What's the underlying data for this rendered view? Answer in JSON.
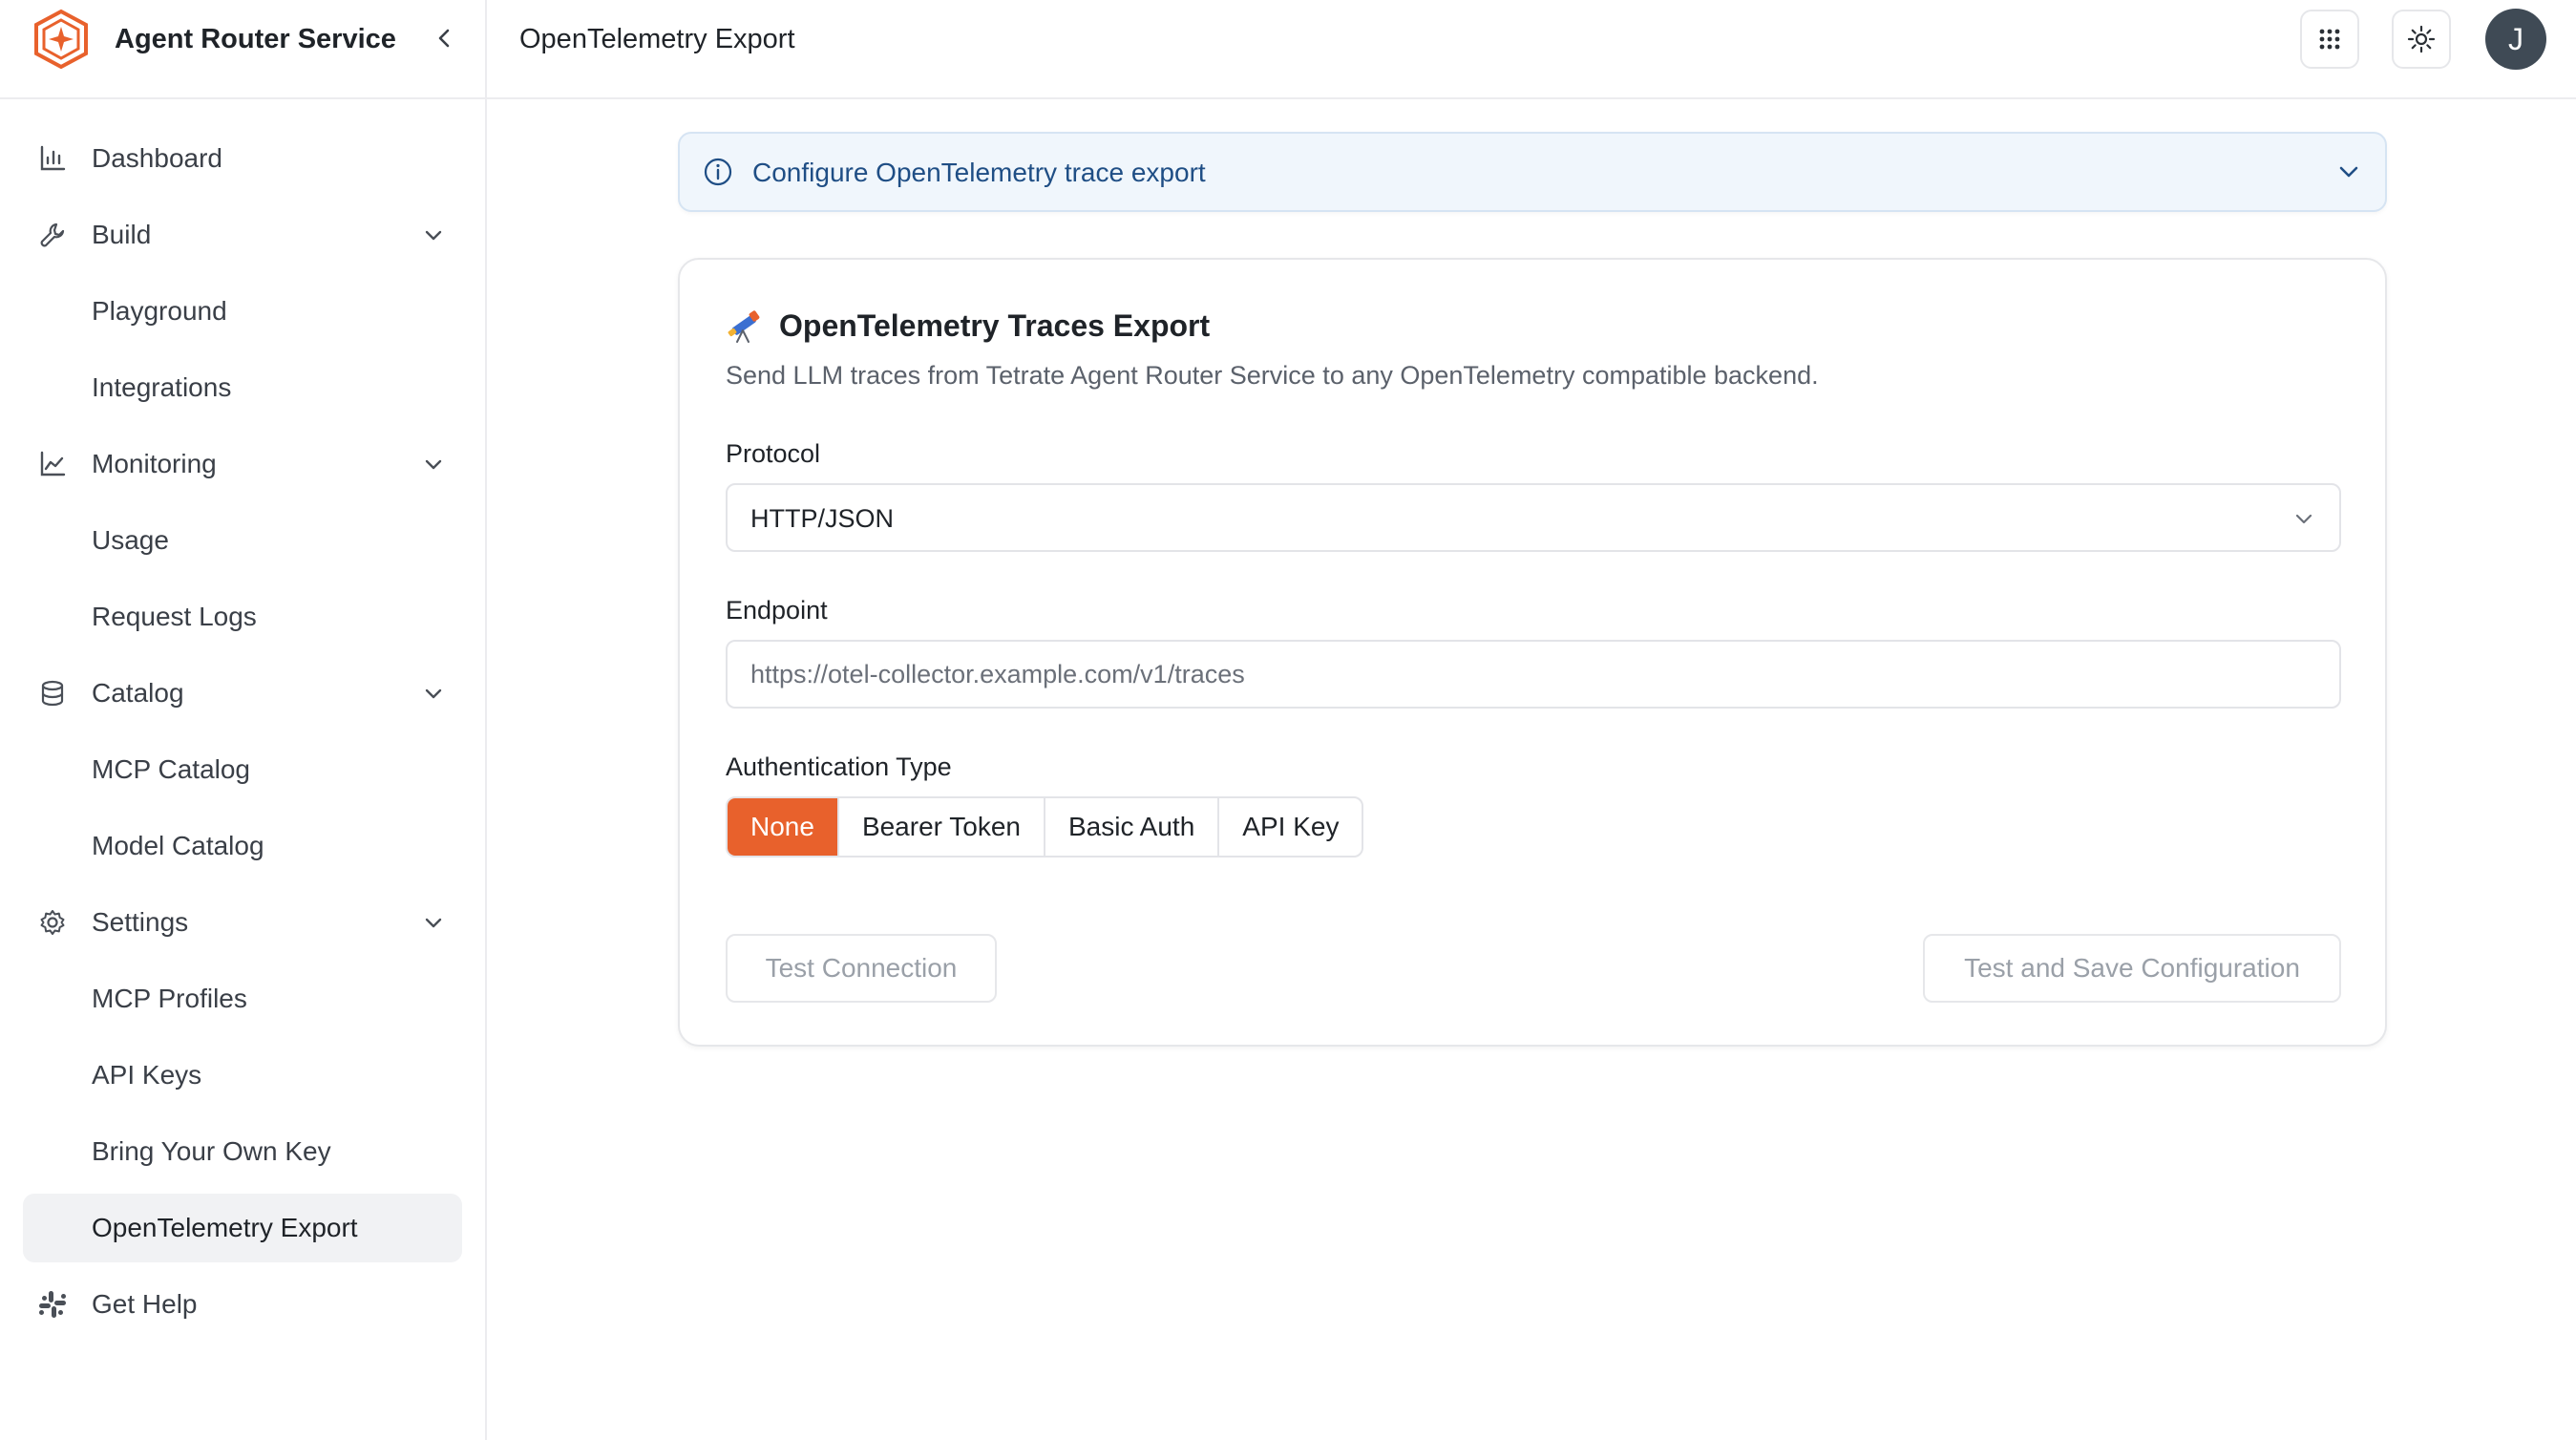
{
  "app": {
    "name": "Agent Router Service"
  },
  "header": {
    "title": "OpenTelemetry Export",
    "avatar_initial": "J"
  },
  "sidebar": {
    "items": [
      {
        "label": "Dashboard",
        "icon": "bar-chart-icon"
      },
      {
        "label": "Build",
        "icon": "wrench-icon",
        "expandable": true
      },
      {
        "label": "Playground",
        "sub": true
      },
      {
        "label": "Integrations",
        "sub": true
      },
      {
        "label": "Monitoring",
        "icon": "line-chart-icon",
        "expandable": true
      },
      {
        "label": "Usage",
        "sub": true
      },
      {
        "label": "Request Logs",
        "sub": true
      },
      {
        "label": "Catalog",
        "icon": "database-icon",
        "expandable": true
      },
      {
        "label": "MCP Catalog",
        "sub": true
      },
      {
        "label": "Model Catalog",
        "sub": true
      },
      {
        "label": "Settings",
        "icon": "gear-icon",
        "expandable": true
      },
      {
        "label": "MCP Profiles",
        "sub": true
      },
      {
        "label": "API Keys",
        "sub": true
      },
      {
        "label": "Bring Your Own Key",
        "sub": true
      },
      {
        "label": "OpenTelemetry Export",
        "sub": true,
        "active": true
      },
      {
        "label": "Get Help",
        "icon": "slack-icon"
      }
    ]
  },
  "banner": {
    "text": "Configure OpenTelemetry trace export"
  },
  "card": {
    "title": "OpenTelemetry Traces Export",
    "description": "Send LLM traces from Tetrate Agent Router Service to any OpenTelemetry compatible backend.",
    "protocol": {
      "label": "Protocol",
      "value": "HTTP/JSON"
    },
    "endpoint": {
      "label": "Endpoint",
      "placeholder": "https://otel-collector.example.com/v1/traces"
    },
    "auth": {
      "label": "Authentication Type",
      "options": [
        "None",
        "Bearer Token",
        "Basic Auth",
        "API Key"
      ],
      "selected": "None"
    },
    "buttons": {
      "test": "Test Connection",
      "save": "Test and Save Configuration"
    }
  },
  "colors": {
    "accent": "#e8612c",
    "banner_bg": "#f0f6fc",
    "banner_text": "#1f4e85"
  }
}
